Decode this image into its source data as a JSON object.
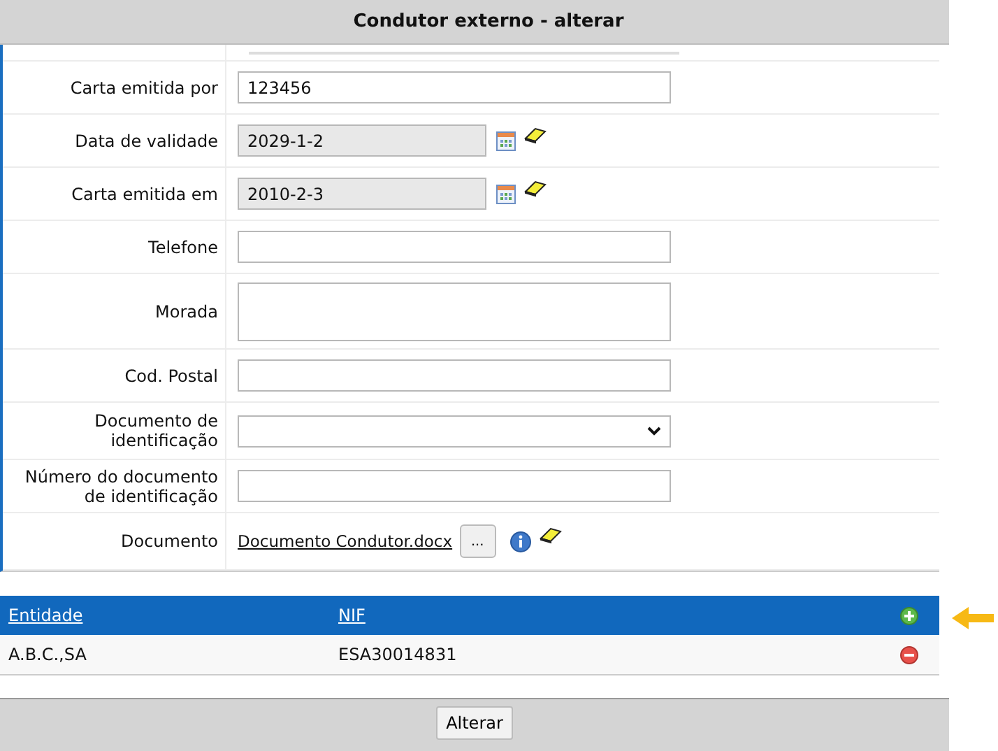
{
  "window": {
    "title": "Condutor externo - alterar"
  },
  "fields": [
    {
      "kind": "text",
      "label": "Carta emitida por",
      "value": "123456"
    },
    {
      "kind": "date",
      "label": "Data de validade",
      "value": "2029-1-2"
    },
    {
      "kind": "date",
      "label": "Carta emitida em",
      "value": "2010-2-3"
    },
    {
      "kind": "text",
      "label": "Telefone"
    },
    {
      "kind": "textarea",
      "label": "Morada"
    },
    {
      "kind": "text",
      "label": "Cod. Postal"
    },
    {
      "kind": "select",
      "label": "Documento de identificação"
    },
    {
      "kind": "text",
      "label": "Número do documento de identificação"
    },
    {
      "kind": "file",
      "label": "Documento",
      "value": "Documento Condutor.docx",
      "browse": "..."
    }
  ],
  "table": {
    "columns": [
      "Entidade",
      "NIF"
    ],
    "rows": [
      {
        "entidade": "A.B.C.,SA",
        "nif": "ESA30014831"
      }
    ]
  },
  "footer": {
    "button": "Alterar"
  }
}
